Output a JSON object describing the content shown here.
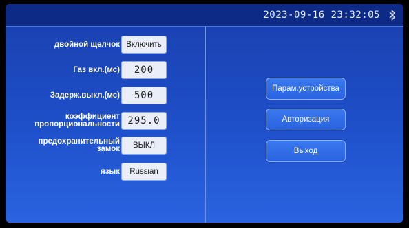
{
  "header": {
    "datetime": "2023-09-16 23:32:05",
    "status_icon": "bluetooth-icon"
  },
  "settings": [
    {
      "label": "двойной щелчок",
      "value": "Включить"
    },
    {
      "label": "Газ вкл.(мс)",
      "value": "200"
    },
    {
      "label": "Задерж.выкл.(мс)",
      "value": "500"
    },
    {
      "label": "коэффициент\nпропорциональности",
      "value": "295.0"
    },
    {
      "label": "предохранительный\nзамок",
      "value": "ВЫКЛ"
    },
    {
      "label": "язык",
      "value": "Russian"
    }
  ],
  "buttons": {
    "device_params": "Парам.устройства",
    "authorization": "Авторизация",
    "exit": "Выход"
  }
}
